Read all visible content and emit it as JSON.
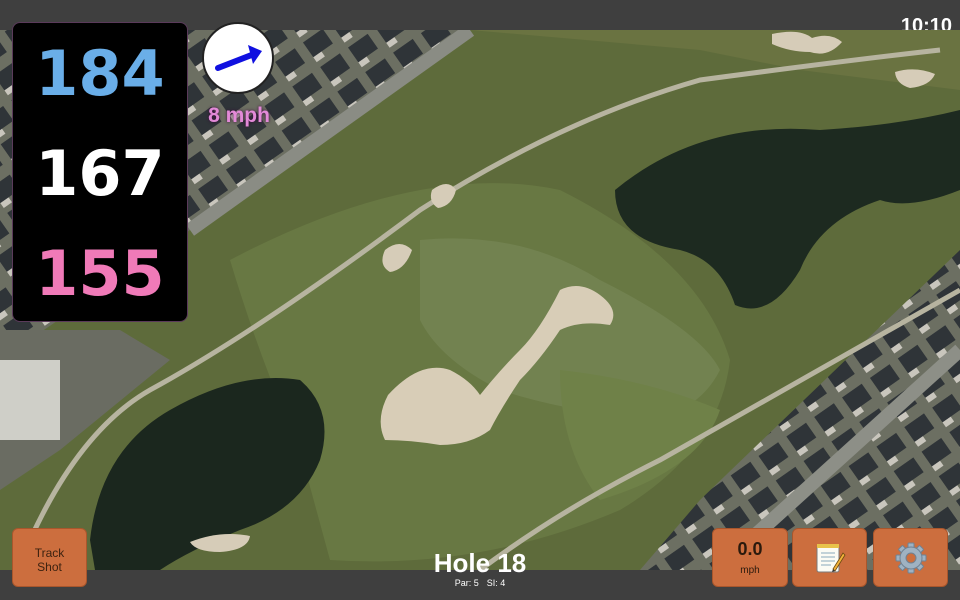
{
  "status_bar": {
    "time": "10:10"
  },
  "distances": {
    "back": "184",
    "middle": "167",
    "front": "155"
  },
  "wind": {
    "speed_label": "8 mph",
    "direction_icon": "wind-arrow-icon"
  },
  "hole": {
    "title": "Hole 18",
    "par": "Par: 5",
    "stroke_index": "SI: 4"
  },
  "buttons": {
    "track_line1": "Track",
    "track_line2": "Shot",
    "wind_value": "0.0",
    "wind_unit": "mph",
    "notes_icon": "notepad-icon",
    "settings_icon": "gear-icon"
  },
  "colors": {
    "back_distance": "#6aaee8",
    "middle_distance": "#ffffff",
    "front_distance": "#f07ab8",
    "wind_text": "#e38ad8",
    "button_bg": "#cc6e3e",
    "bar_bg": "#3f3f3f"
  }
}
